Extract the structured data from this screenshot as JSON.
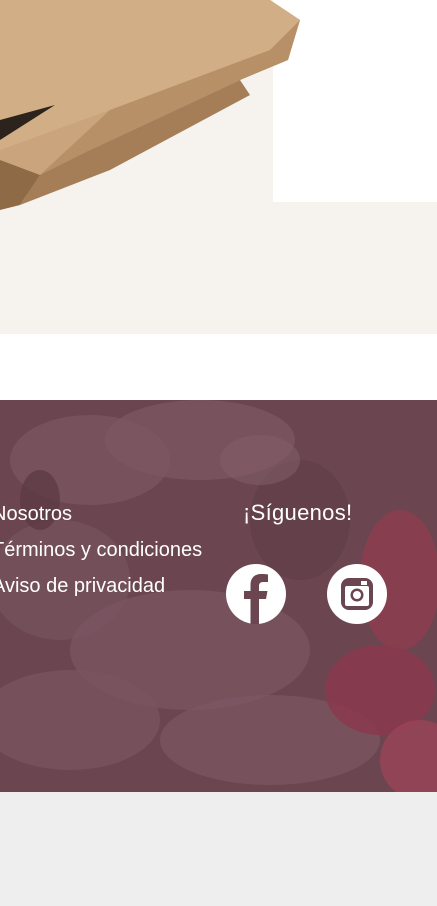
{
  "footer": {
    "links": [
      "Nosotros",
      "Términos y condiciones",
      "Aviso de privacidad"
    ],
    "follow_label": "¡Síguenos!",
    "social": [
      {
        "name": "facebook",
        "icon": "facebook-icon"
      },
      {
        "name": "instagram",
        "icon": "instagram-icon"
      }
    ]
  },
  "colors": {
    "footer_bg": "#6b4650",
    "hero_bg": "#f6f3ef",
    "bottom_bg": "#eeeeef"
  }
}
